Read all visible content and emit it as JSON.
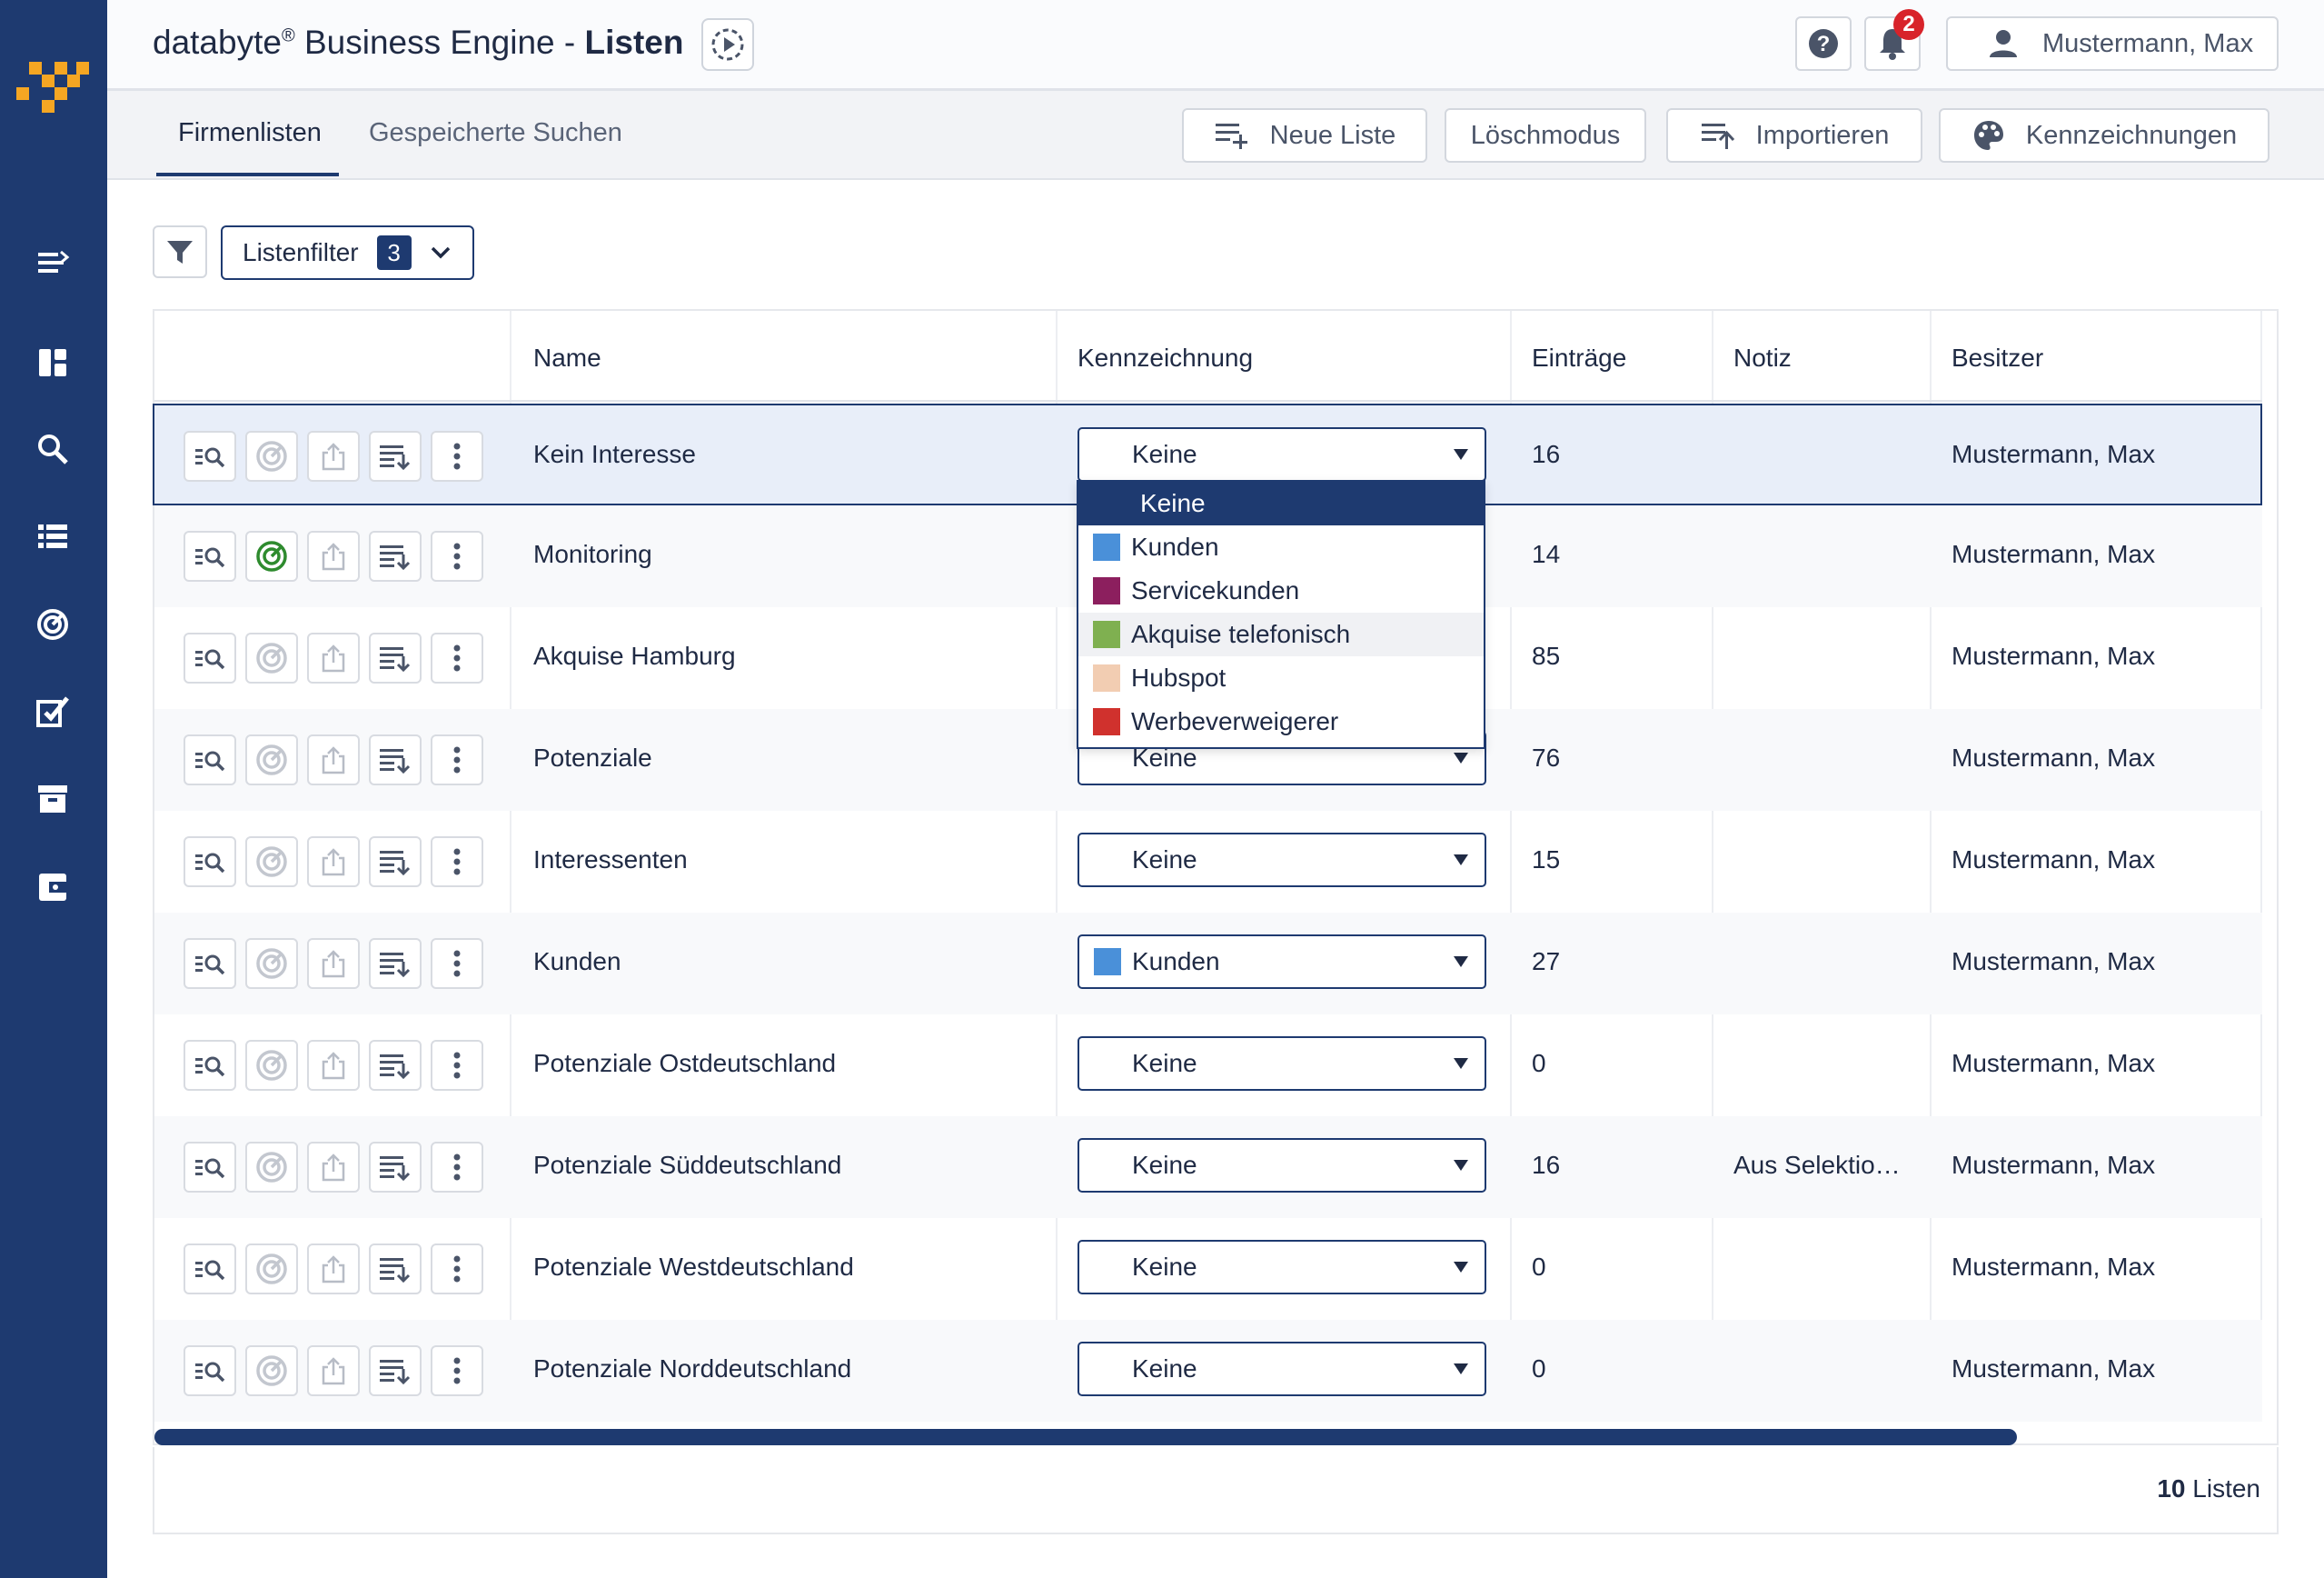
{
  "header": {
    "brand": "databyte",
    "brand_reg": "®",
    "product": " Business Engine - ",
    "page": "Listen",
    "notifications": "2",
    "user": "Mustermann, Max"
  },
  "tabs": [
    "Firmenlisten",
    "Gespeicherte Suchen"
  ],
  "toolbar": {
    "new_list": "Neue Liste",
    "delete_mode": "Löschmodus",
    "import": "Importieren",
    "labels": "Kennzeichnungen"
  },
  "filter": {
    "label": "Listenfilter",
    "count": "3"
  },
  "columns": {
    "name": "Name",
    "label": "Kennzeichnung",
    "entries": "Einträge",
    "note": "Notiz",
    "owner": "Besitzer"
  },
  "rows": [
    {
      "name": "Kein Interesse",
      "label": "Keine",
      "entries": "16",
      "note": "",
      "owner": "Mustermann, Max"
    },
    {
      "name": "Monitoring",
      "label": "",
      "entries": "14",
      "note": "",
      "owner": "Mustermann, Max"
    },
    {
      "name": "Akquise Hamburg",
      "label": "",
      "entries": "85",
      "note": "",
      "owner": "Mustermann, Max"
    },
    {
      "name": "Potenziale",
      "label": "Keine",
      "entries": "76",
      "note": "",
      "owner": "Mustermann, Max"
    },
    {
      "name": "Interessenten",
      "label": "Keine",
      "entries": "15",
      "note": "",
      "owner": "Mustermann, Max"
    },
    {
      "name": "Kunden",
      "label": "Kunden",
      "entries": "27",
      "note": "",
      "owner": "Mustermann, Max"
    },
    {
      "name": "Potenziale Ostdeutschland",
      "label": "Keine",
      "entries": "0",
      "note": "",
      "owner": "Mustermann, Max"
    },
    {
      "name": "Potenziale Süddeutschland",
      "label": "Keine",
      "entries": "16",
      "note": "Aus Selektio…",
      "owner": "Mustermann, Max"
    },
    {
      "name": "Potenziale Westdeutschland",
      "label": "Keine",
      "entries": "0",
      "note": "",
      "owner": "Mustermann, Max"
    },
    {
      "name": "Potenziale Norddeutschland",
      "label": "Keine",
      "entries": "0",
      "note": "",
      "owner": "Mustermann, Max"
    }
  ],
  "dropdown": [
    {
      "label": "Keine",
      "color": ""
    },
    {
      "label": "Kunden",
      "color": "#4a90d9"
    },
    {
      "label": "Servicekunden",
      "color": "#8c1f5e"
    },
    {
      "label": "Akquise telefonisch",
      "color": "#7fb050"
    },
    {
      "label": "Hubspot",
      "color": "#f2cdb2"
    },
    {
      "label": "Werbeverweigerer",
      "color": "#d0312d"
    }
  ],
  "colors": {
    "primary": "#1e3a70",
    "accent_green": "#2e8b2e",
    "badge": "#d8232a",
    "logo": "#f5a623"
  },
  "footer": {
    "count": "10",
    "count_label": " Listen"
  }
}
